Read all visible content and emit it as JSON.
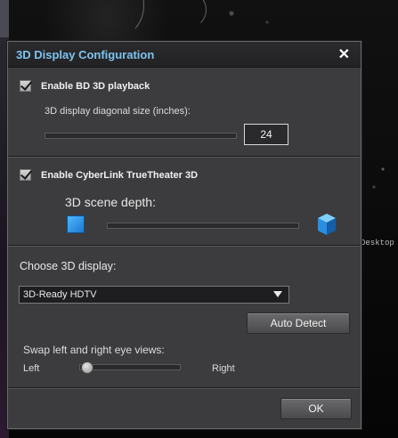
{
  "desktop": {
    "label": "Desktop"
  },
  "dialog": {
    "title": "3D Display Configuration",
    "close_label": "✕",
    "enable_bd3d": {
      "label": "Enable BD 3D playback",
      "checked": true
    },
    "diag_size": {
      "label": "3D display diagonal size (inches):",
      "value": "24"
    },
    "enable_truetheater": {
      "label": "Enable CyberLink TrueTheater 3D",
      "checked": true
    },
    "scene_depth": {
      "label": "3D scene depth:"
    },
    "choose_display": {
      "label": "Choose 3D display:",
      "selected": "3D-Ready HDTV"
    },
    "auto_detect_label": "Auto Detect",
    "swap_eyes": {
      "label": "Swap left and right eye views:",
      "left": "Left",
      "right": "Right",
      "position": 0
    },
    "ok_label": "OK"
  },
  "colors": {
    "title": "#7ec3f0",
    "dialog_bg": "#3c3c3e",
    "cube": "#2f96ea"
  }
}
